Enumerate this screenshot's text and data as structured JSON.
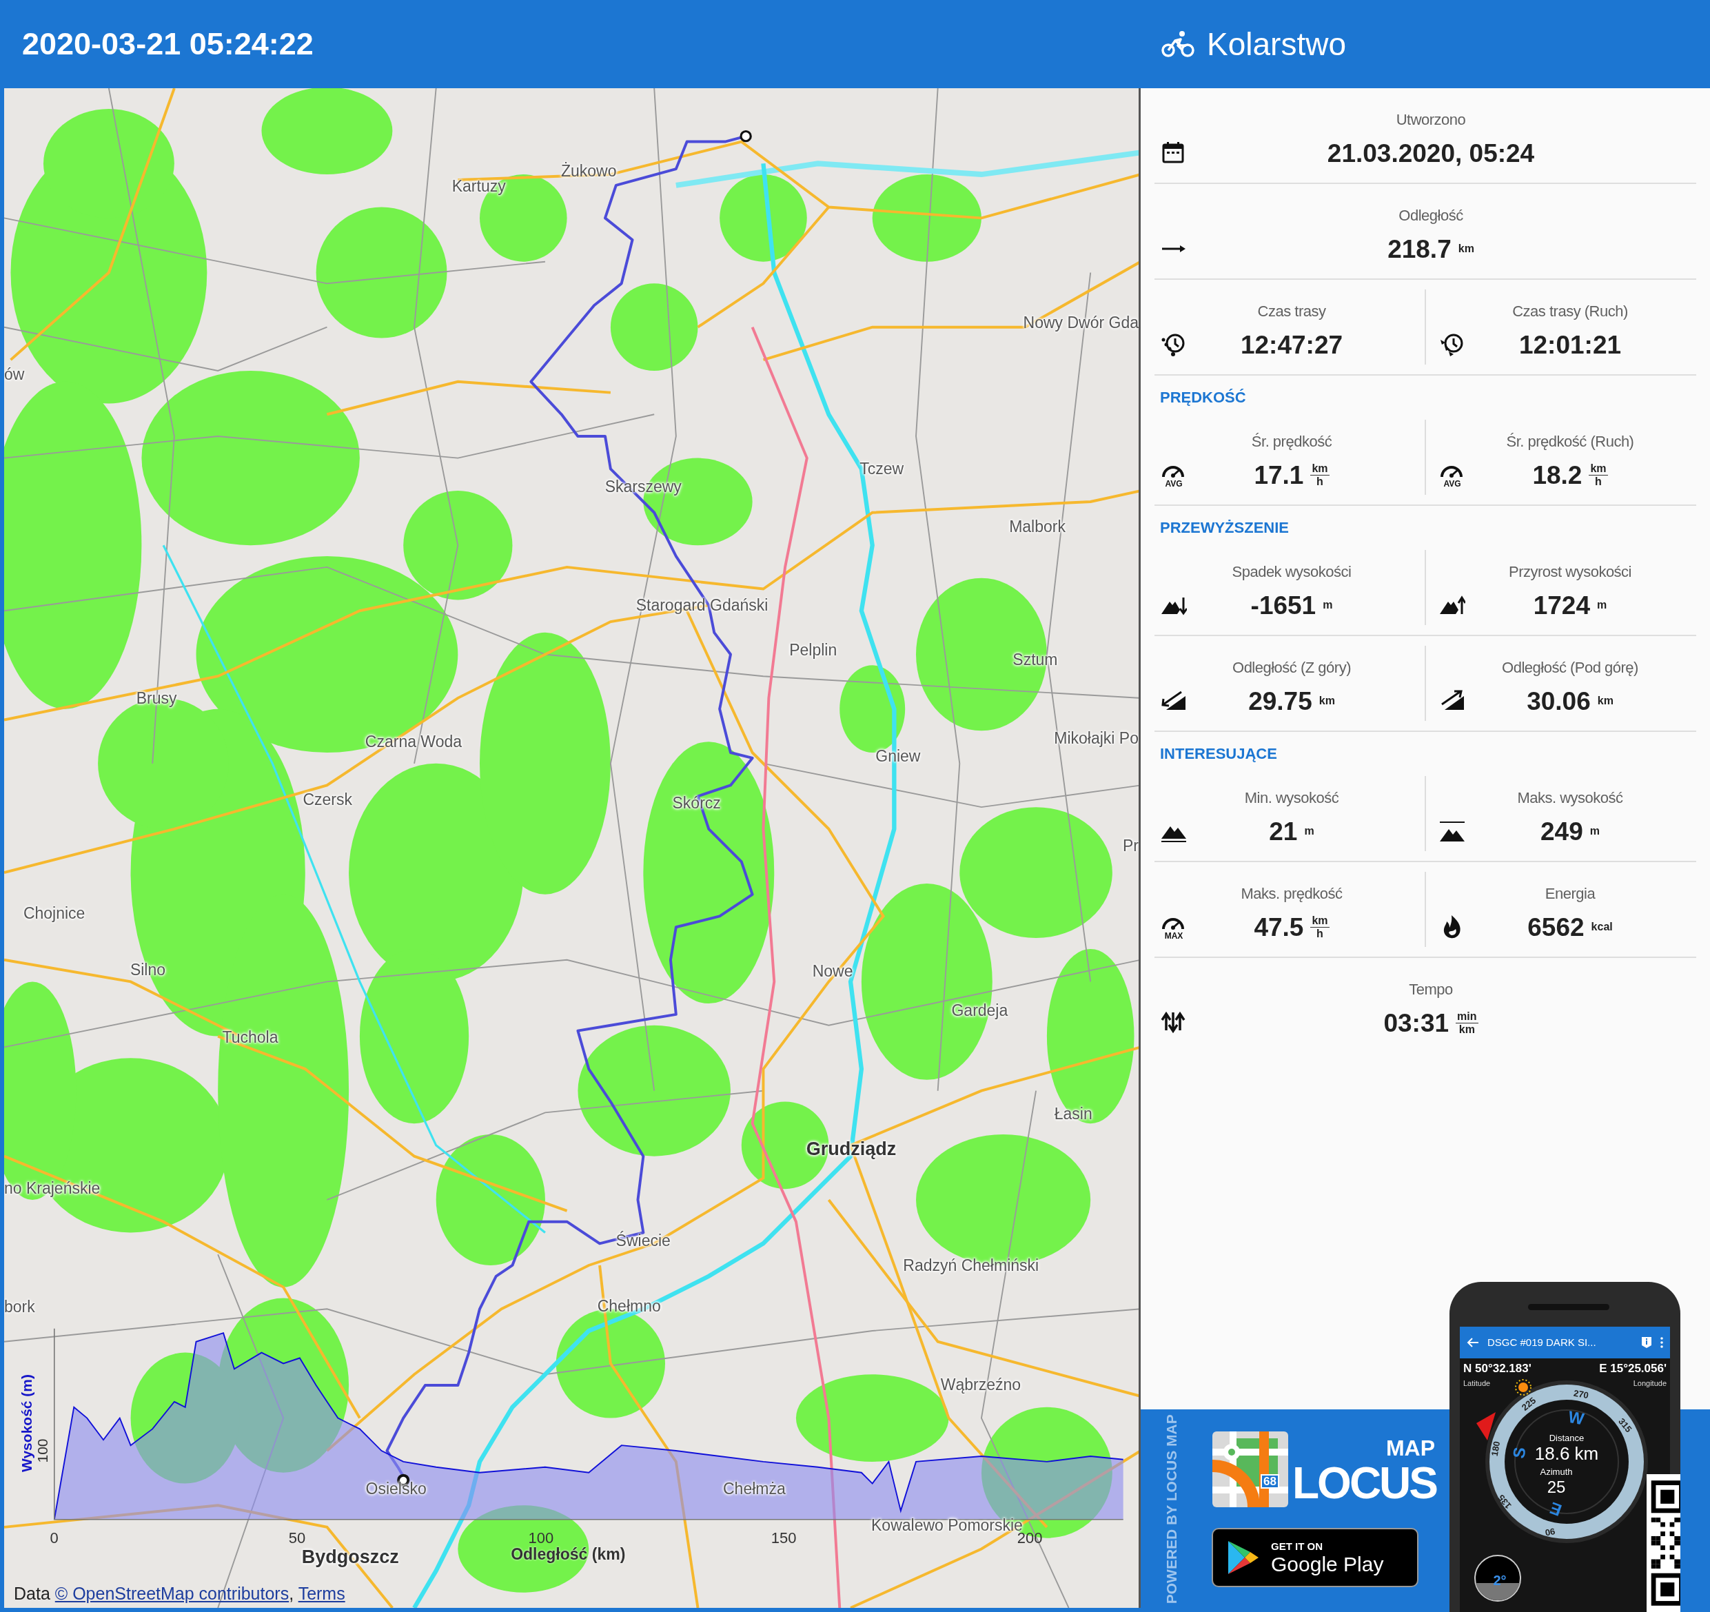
{
  "header": {
    "title": "2020-03-21 05:24:22",
    "activity": "Kolarstwo"
  },
  "map": {
    "places": [
      {
        "name": "Żukowo",
        "kind": "town"
      },
      {
        "name": "Kartuzy",
        "kind": "town"
      },
      {
        "name": "Nowy Dwór Gda",
        "kind": "town"
      },
      {
        "name": "ów",
        "kind": "town"
      },
      {
        "name": "Tczew",
        "kind": "town"
      },
      {
        "name": "Skarszewy",
        "kind": "town"
      },
      {
        "name": "Malbork",
        "kind": "town"
      },
      {
        "name": "Starogard Gdański",
        "kind": "town"
      },
      {
        "name": "Pelplin",
        "kind": "town"
      },
      {
        "name": "Sztum",
        "kind": "town"
      },
      {
        "name": "Brusy",
        "kind": "town"
      },
      {
        "name": "Mikołajki Po",
        "kind": "town"
      },
      {
        "name": "Czarna Woda",
        "kind": "town"
      },
      {
        "name": "Gniew",
        "kind": "town"
      },
      {
        "name": "Czersk",
        "kind": "town"
      },
      {
        "name": "Skórcz",
        "kind": "town"
      },
      {
        "name": "Pr",
        "kind": "town"
      },
      {
        "name": "Chojnice",
        "kind": "town"
      },
      {
        "name": "Silno",
        "kind": "town"
      },
      {
        "name": "Nowe",
        "kind": "town"
      },
      {
        "name": "Gardeja",
        "kind": "town"
      },
      {
        "name": "Tuchola",
        "kind": "town"
      },
      {
        "name": "Łasin",
        "kind": "town"
      },
      {
        "name": "Grudziądz",
        "kind": "city"
      },
      {
        "name": "no Krajeńskie",
        "kind": "town"
      },
      {
        "name": "Świecie",
        "kind": "town"
      },
      {
        "name": "Radzyń Chełmiński",
        "kind": "town"
      },
      {
        "name": "Chełmno",
        "kind": "town"
      },
      {
        "name": "bork",
        "kind": "town"
      },
      {
        "name": "Wąbrzeźno",
        "kind": "town"
      },
      {
        "name": "Osielsko",
        "kind": "town"
      },
      {
        "name": "Chełmża",
        "kind": "town"
      },
      {
        "name": "Kowalewo Pomorskie",
        "kind": "town"
      },
      {
        "name": "Bydgoszcz",
        "kind": "city"
      }
    ],
    "elevation_profile": {
      "ylabel": "Wysokość (m)",
      "yticks": [
        "100"
      ],
      "xlabel": "Odległość (km)",
      "xticks": [
        "0",
        "50",
        "100",
        "150",
        "200"
      ]
    },
    "attribution": {
      "prefix": "Data",
      "source_link": "© OpenStreetMap contributors",
      "separator": ",",
      "terms_link": "Terms"
    }
  },
  "stats": [
    {
      "kind": "single",
      "label": "Utworzono",
      "value": "21.03.2020, 05:24"
    },
    {
      "kind": "single",
      "label": "Odległość",
      "value": "218.7",
      "unit": "km"
    },
    {
      "kind": "pair",
      "cells": [
        {
          "label": "Czas trasy",
          "value": "12:47:27"
        },
        {
          "label": "Czas trasy (Ruch)",
          "value": "12:01:21"
        }
      ]
    },
    {
      "kind": "heading",
      "text": "PRĘDKOŚĆ"
    },
    {
      "kind": "pair",
      "cells": [
        {
          "label": "Śr. prędkość",
          "value": "17.1",
          "unit_top": "km",
          "unit_bottom": "h",
          "icon_text": "AVG"
        },
        {
          "label": "Śr. prędkość (Ruch)",
          "value": "18.2",
          "unit_top": "km",
          "unit_bottom": "h",
          "icon_text": "AVG"
        }
      ]
    },
    {
      "kind": "heading",
      "text": "PRZEWYŻSZENIE"
    },
    {
      "kind": "pair",
      "cells": [
        {
          "label": "Spadek wysokości",
          "value": "-1651",
          "unit": "m"
        },
        {
          "label": "Przyrost wysokości",
          "value": "1724",
          "unit": "m"
        }
      ]
    },
    {
      "kind": "pair",
      "cells": [
        {
          "label": "Odległość (Z góry)",
          "value": "29.75",
          "unit": "km"
        },
        {
          "label": "Odległość (Pod górę)",
          "value": "30.06",
          "unit": "km"
        }
      ]
    },
    {
      "kind": "heading",
      "text": "INTERESUJĄCE"
    },
    {
      "kind": "pair",
      "cells": [
        {
          "label": "Min. wysokość",
          "value": "21",
          "unit": "m"
        },
        {
          "label": "Maks. wysokość",
          "value": "249",
          "unit": "m"
        }
      ]
    },
    {
      "kind": "pair",
      "cells": [
        {
          "label": "Maks. prędkość",
          "value": "47.5",
          "unit_top": "km",
          "unit_bottom": "h",
          "icon_text": "MAX"
        },
        {
          "label": "Energia",
          "value": "6562",
          "unit": "kcal"
        }
      ]
    },
    {
      "kind": "single",
      "label": "Tempo",
      "value": "03:31",
      "unit_top": "min",
      "unit_bottom": "km"
    }
  ],
  "promo": {
    "vertical_text": "POWERED BY LOCUS MAP",
    "logo_small": "MAP",
    "logo_big": "LOCUS",
    "logo_badge": "68",
    "store_button": {
      "top": "GET IT ON",
      "bottom": "Google Play"
    },
    "phone": {
      "toolbar_title": "DSGC #019 DARK SI...",
      "latitude": "N 50°32.183'",
      "latitude_label": "Latitude",
      "longitude": "E 15°25.056'",
      "longitude_label": "Longitude",
      "dial_labels": [
        "270",
        "225",
        "315",
        "180",
        "135",
        "90"
      ],
      "cardinals": [
        "W",
        "S",
        "E"
      ],
      "distance_label": "Distance",
      "distance": "18.6 km",
      "azimuth_label": "Azimuth",
      "azimuth": "25",
      "tilt": "2°"
    }
  }
}
